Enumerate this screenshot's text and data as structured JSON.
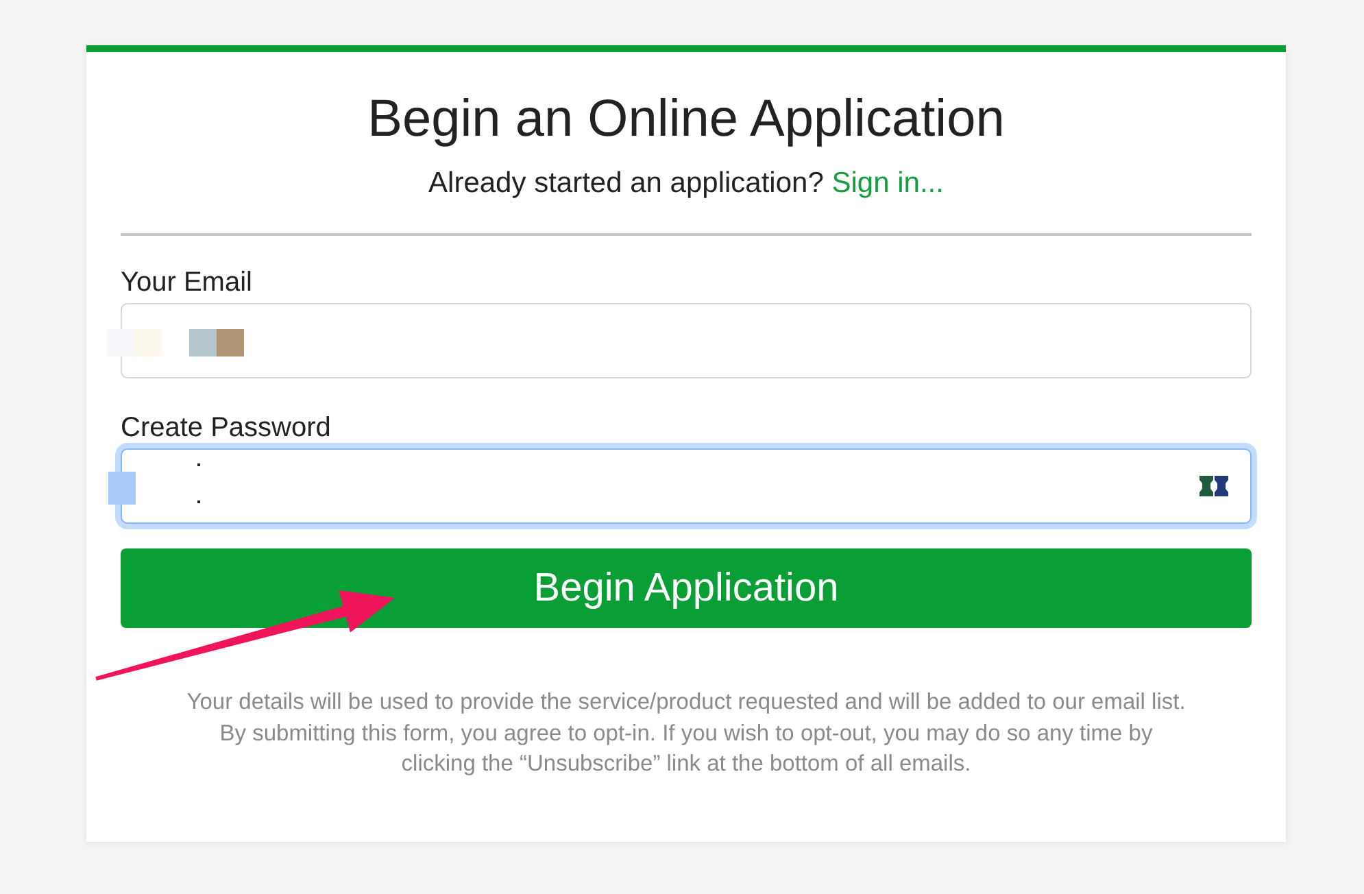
{
  "header": {
    "title": "Begin an Online Application",
    "signin_prompt": "Already started an application?",
    "signin_link": "Sign in..."
  },
  "fields": [
    {
      "kind": "email",
      "label": "Your Email",
      "focused": false
    },
    {
      "kind": "password",
      "label": "Create Password",
      "focused": true
    }
  ],
  "submit_button": "Begin Application",
  "disclaimer": "Your details will be used to provide the service/product requested and will be added to our email list. By submitting this form, you agree to opt-in. If you wish to opt-out, you may do so any time by clicking the “Unsubscribe” link at the bottom of all emails."
}
